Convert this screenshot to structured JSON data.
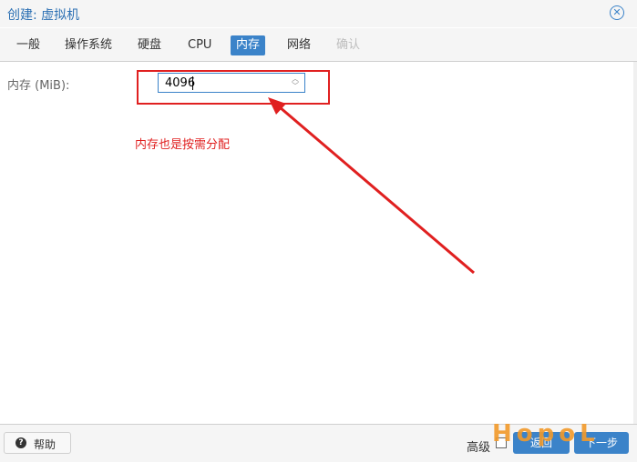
{
  "window": {
    "title": "创建: 虚拟机"
  },
  "tabs": [
    {
      "label": "一般"
    },
    {
      "label": "操作系统"
    },
    {
      "label": "硬盘"
    },
    {
      "label": "CPU"
    },
    {
      "label": "内存"
    },
    {
      "label": "网络"
    },
    {
      "label": "确认"
    }
  ],
  "memory": {
    "label": "内存 (MiB):",
    "value": "4096"
  },
  "annotation": {
    "text": "内存也是按需分配",
    "color": "#e02020"
  },
  "footer": {
    "help_label": "帮助",
    "advanced_label": "高级",
    "back_label": "返回",
    "next_label": "下一步"
  },
  "watermark": {
    "text": "HopoL"
  },
  "colors": {
    "accent": "#3b83c9",
    "annotation": "#e02020"
  }
}
